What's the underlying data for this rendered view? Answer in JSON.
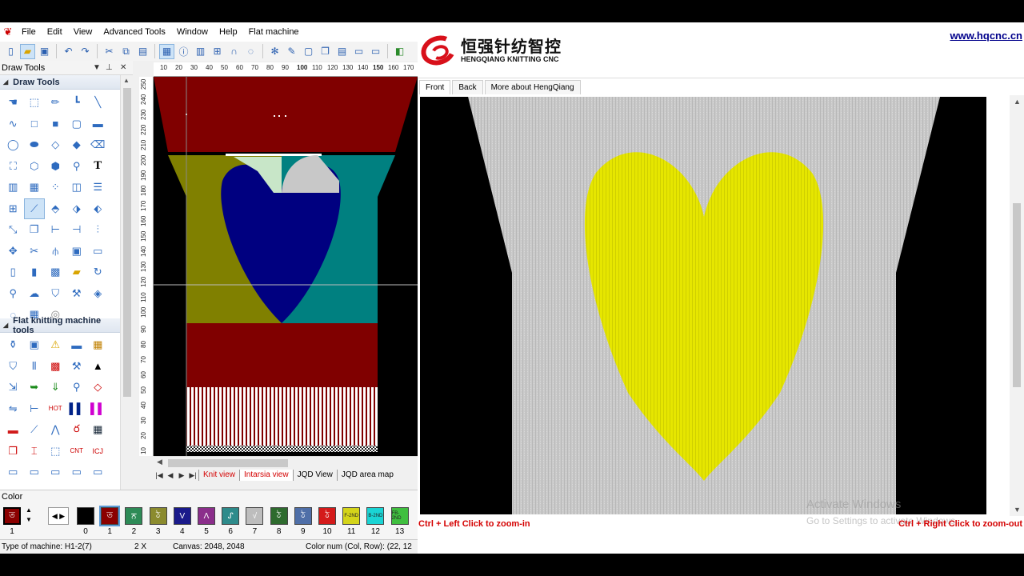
{
  "menu": [
    "File",
    "Edit",
    "View",
    "Advanced Tools",
    "Window",
    "Help",
    "Flat machine"
  ],
  "draw_panel": {
    "title": "Draw Tools",
    "section1": "Draw Tools",
    "section2": "Flat knitting machine tools"
  },
  "ruler_top": [
    "10",
    "20",
    "30",
    "40",
    "50",
    "60",
    "70",
    "80",
    "90",
    "100",
    "110",
    "120",
    "130",
    "140",
    "150",
    "160",
    "170"
  ],
  "ruler_left": [
    "250",
    "240",
    "230",
    "220",
    "210",
    "200",
    "190",
    "180",
    "170",
    "160",
    "150",
    "140",
    "130",
    "120",
    "110",
    "100",
    "90",
    "80",
    "70",
    "60",
    "50",
    "40",
    "30",
    "20",
    "10"
  ],
  "view_tabs": [
    "Knit view",
    "Intarsia view",
    "JQD View",
    "JQD area map"
  ],
  "color": {
    "title": "Color",
    "current": "1",
    "swatches": [
      {
        "n": "0",
        "color": "#000000",
        "glyph": ""
      },
      {
        "n": "1",
        "color": "#8b0000",
        "glyph": "ত"
      },
      {
        "n": "2",
        "color": "#2e8b57",
        "glyph": "ਨ"
      },
      {
        "n": "3",
        "color": "#8b8b2e",
        "glyph": "ঠ"
      },
      {
        "n": "4",
        "color": "#1a1a8b",
        "glyph": "V"
      },
      {
        "n": "5",
        "color": "#8b2e8b",
        "glyph": "Λ"
      },
      {
        "n": "6",
        "color": "#2e8b8b",
        "glyph": "ᔑ"
      },
      {
        "n": "7",
        "color": "#bdbdbd",
        "glyph": "√"
      },
      {
        "n": "8",
        "color": "#2e6b2e",
        "glyph": "ঠ"
      },
      {
        "n": "9",
        "color": "#4f6fa8",
        "glyph": "ঠ"
      },
      {
        "n": "10",
        "color": "#d41a1a",
        "glyph": "ঠ"
      },
      {
        "n": "11",
        "color": "#d4d41a",
        "glyph": "F-2ND"
      },
      {
        "n": "12",
        "color": "#1ad4d4",
        "glyph": "B-2ND"
      },
      {
        "n": "13",
        "color": "#3fbf3f",
        "glyph": "FB-2ND"
      }
    ]
  },
  "status": {
    "machine": "Type of machine: H1-2(7)",
    "zoom": "2 X",
    "canvas": "Canvas: 2048, 2048",
    "colornum": "Color num  (Col, Row): (22, 12"
  },
  "web": {
    "logo_cn": "恒强针纺智控",
    "logo_en": "HENGQIANG KNITTING CNC",
    "url": "www.hqcnc.cn",
    "tabs": [
      "Front",
      "Back",
      "More about HengQiang"
    ],
    "hint_left": "Ctrl + Left Click to zoom-in",
    "hint_right": "Ctrl + Right Click to zoom-out",
    "watermark1": "Activate Windows",
    "watermark2": "Go to Settings to activate Windows."
  },
  "colors": {
    "body_dark_red": "#800000",
    "olive": "#808000",
    "teal": "#008080",
    "navy": "#000080",
    "heart_yellow": "#e6e600",
    "knit_grey": "#c8c8c8"
  }
}
